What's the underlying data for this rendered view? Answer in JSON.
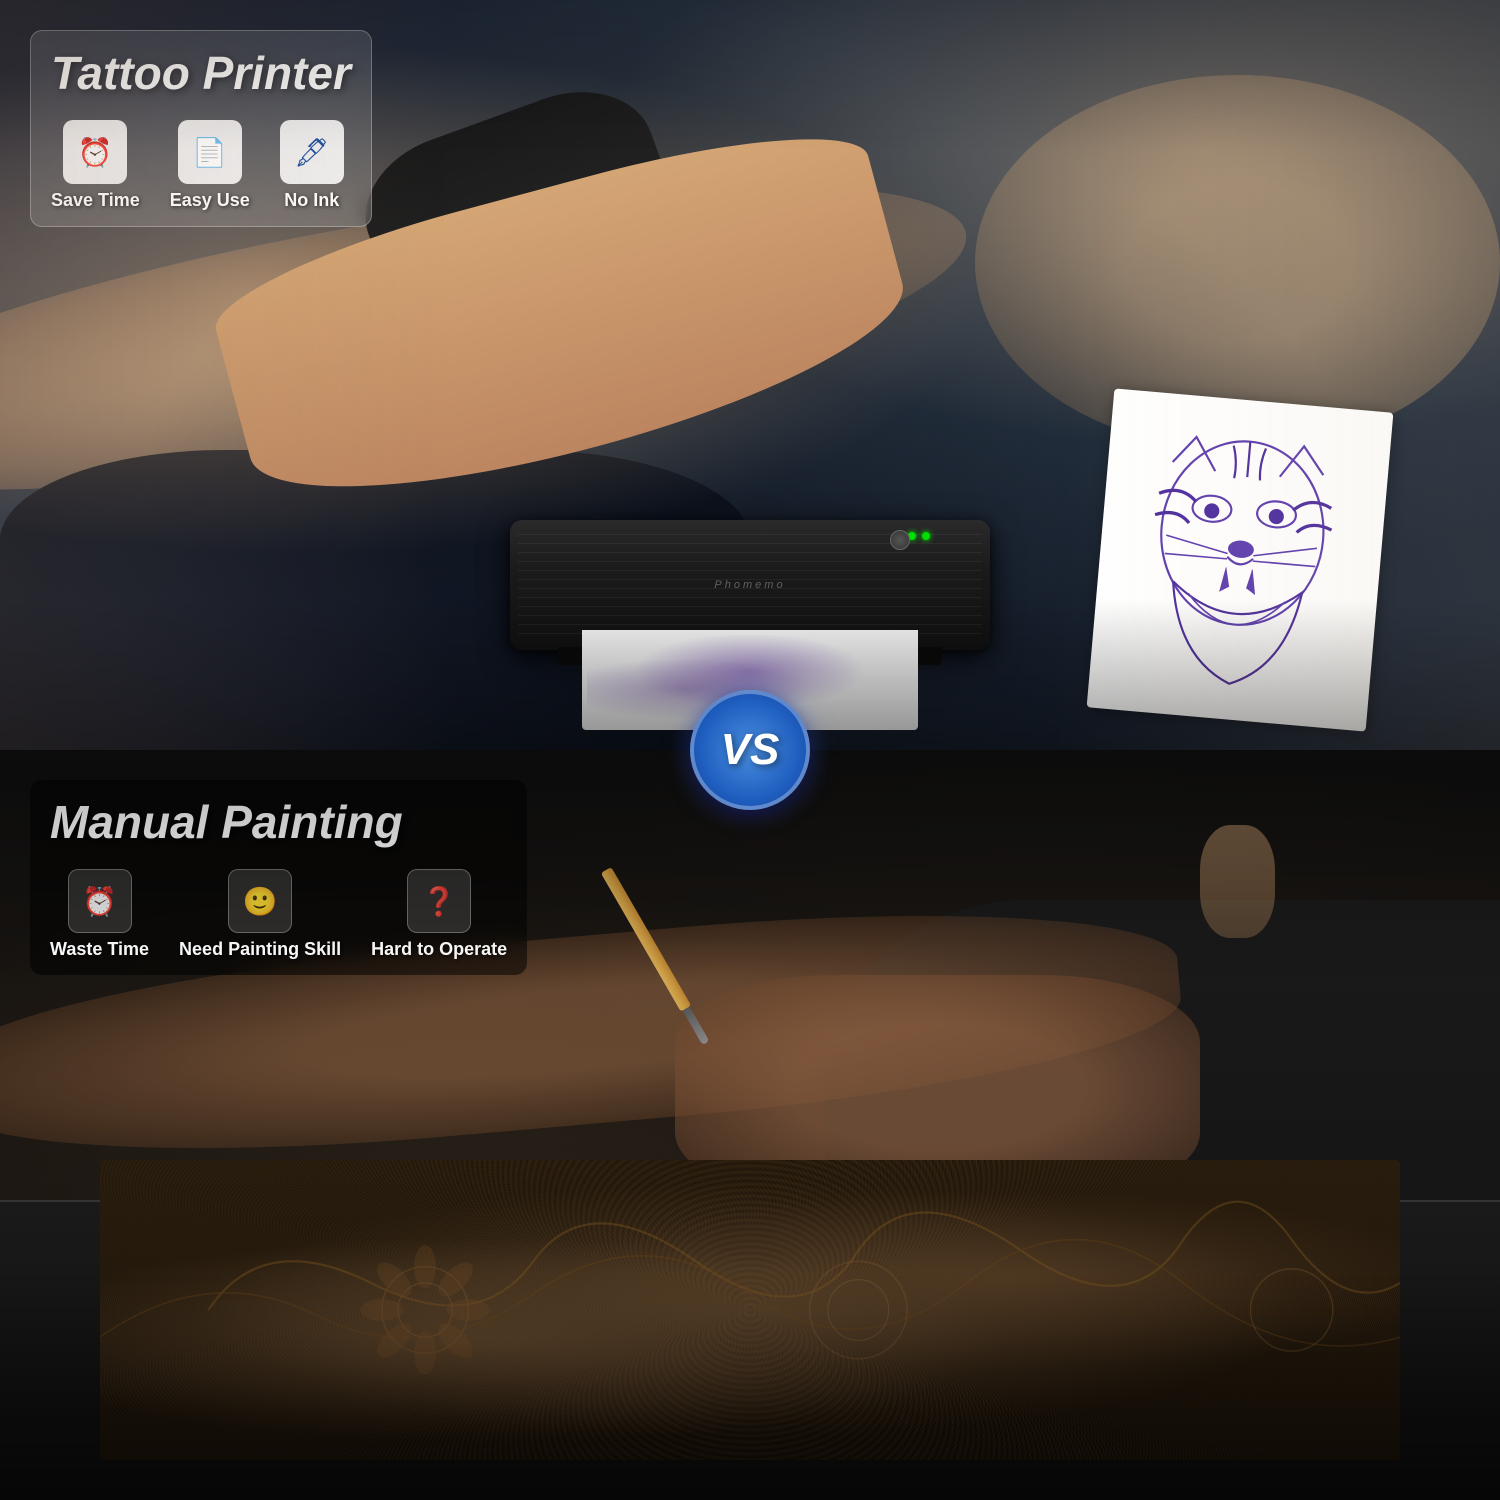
{
  "top": {
    "title": "Tattoo Printer",
    "features": [
      {
        "id": "save-time",
        "icon": "⏰",
        "label": "Save Time"
      },
      {
        "id": "easy-use",
        "icon": "📋",
        "label": "Easy Use"
      },
      {
        "id": "no-ink",
        "icon": "🖋",
        "label": "No Ink"
      }
    ],
    "printer_brand": "Phomemo"
  },
  "vs": {
    "label": "VS"
  },
  "bottom": {
    "title": "Manual Painting",
    "features": [
      {
        "id": "waste-time",
        "icon": "⏰",
        "label": "Waste Time"
      },
      {
        "id": "need-skill",
        "icon": "😐",
        "label": "Need Painting Skill"
      },
      {
        "id": "hard-operate",
        "icon": "❓",
        "label": "Hard to Operate"
      }
    ]
  }
}
